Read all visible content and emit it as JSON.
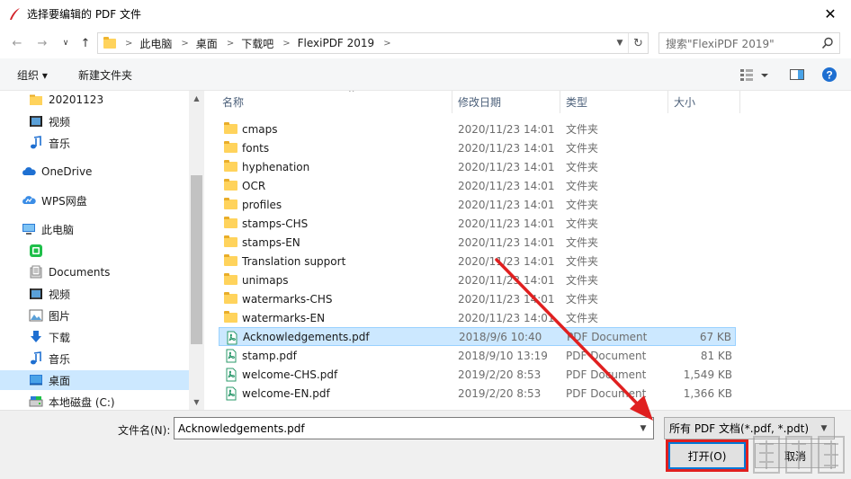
{
  "window": {
    "title": "选择要编辑的 PDF 文件",
    "close_glyph": "✕"
  },
  "address": {
    "back_glyph": "←",
    "forward_glyph": "→",
    "recent_glyph": "∨",
    "up_glyph": "↑",
    "crumbs": [
      "此电脑",
      "桌面",
      "下载吧",
      "FlexiPDF 2019"
    ],
    "crumb_sep": ">",
    "refresh_glyph": "↻"
  },
  "search": {
    "placeholder": "搜索\"FlexiPDF 2019\""
  },
  "toolbar": {
    "organize": "组织 ▾",
    "new_folder": "新建文件夹"
  },
  "sidebar": {
    "items": [
      {
        "label": "20201123",
        "icon": "folder-icon"
      },
      {
        "label": "视频",
        "icon": "video-icon"
      },
      {
        "label": "音乐",
        "icon": "music-icon"
      },
      {
        "label": "OneDrive",
        "icon": "cloud-icon"
      },
      {
        "label": "WPS网盘",
        "icon": "wps-cloud-icon"
      },
      {
        "label": "此电脑",
        "icon": "computer-icon"
      },
      {
        "label": "",
        "icon": "phone-drive-icon"
      },
      {
        "label": "Documents",
        "icon": "documents-icon"
      },
      {
        "label": "视频",
        "icon": "video-icon"
      },
      {
        "label": "图片",
        "icon": "pictures-icon"
      },
      {
        "label": "下载",
        "icon": "download-icon"
      },
      {
        "label": "音乐",
        "icon": "music-icon"
      },
      {
        "label": "桌面",
        "icon": "desktop-icon"
      },
      {
        "label": "本地磁盘 (C:)",
        "icon": "disk-icon"
      }
    ]
  },
  "columns": {
    "name": "名称",
    "modified": "修改日期",
    "type": "类型",
    "size": "大小"
  },
  "files": [
    {
      "name": "cmaps",
      "date": "2020/11/23 14:01",
      "type": "文件夹",
      "size": "",
      "kind": "folder"
    },
    {
      "name": "fonts",
      "date": "2020/11/23 14:01",
      "type": "文件夹",
      "size": "",
      "kind": "folder"
    },
    {
      "name": "hyphenation",
      "date": "2020/11/23 14:01",
      "type": "文件夹",
      "size": "",
      "kind": "folder"
    },
    {
      "name": "OCR",
      "date": "2020/11/23 14:01",
      "type": "文件夹",
      "size": "",
      "kind": "folder"
    },
    {
      "name": "profiles",
      "date": "2020/11/23 14:01",
      "type": "文件夹",
      "size": "",
      "kind": "folder"
    },
    {
      "name": "stamps-CHS",
      "date": "2020/11/23 14:01",
      "type": "文件夹",
      "size": "",
      "kind": "folder"
    },
    {
      "name": "stamps-EN",
      "date": "2020/11/23 14:01",
      "type": "文件夹",
      "size": "",
      "kind": "folder"
    },
    {
      "name": "Translation support",
      "date": "2020/11/23 14:01",
      "type": "文件夹",
      "size": "",
      "kind": "folder"
    },
    {
      "name": "unimaps",
      "date": "2020/11/23 14:01",
      "type": "文件夹",
      "size": "",
      "kind": "folder"
    },
    {
      "name": "watermarks-CHS",
      "date": "2020/11/23 14:01",
      "type": "文件夹",
      "size": "",
      "kind": "folder"
    },
    {
      "name": "watermarks-EN",
      "date": "2020/11/23 14:01",
      "type": "文件夹",
      "size": "",
      "kind": "folder"
    },
    {
      "name": "Acknowledgements.pdf",
      "date": "2018/9/6 10:40",
      "type": "PDF Document",
      "size": "67 KB",
      "kind": "pdf"
    },
    {
      "name": "stamp.pdf",
      "date": "2018/9/10 13:19",
      "type": "PDF Document",
      "size": "81 KB",
      "kind": "pdf"
    },
    {
      "name": "welcome-CHS.pdf",
      "date": "2019/2/20 8:53",
      "type": "PDF Document",
      "size": "1,549 KB",
      "kind": "pdf"
    },
    {
      "name": "welcome-EN.pdf",
      "date": "2019/2/20 8:53",
      "type": "PDF Document",
      "size": "1,366 KB",
      "kind": "pdf"
    }
  ],
  "selected_index": 11,
  "bottom": {
    "filename_label": "文件名(N):",
    "filename_value": "Acknowledgements.pdf",
    "filter_value": "所有 PDF 文档(*.pdf, *.pdt)",
    "open_label": "打开(O)",
    "cancel_label": "取消"
  },
  "colors": {
    "accent": "#0078d7",
    "selection": "#cce8ff",
    "annotation_red": "#e02020",
    "folder": "#ffd35c"
  }
}
